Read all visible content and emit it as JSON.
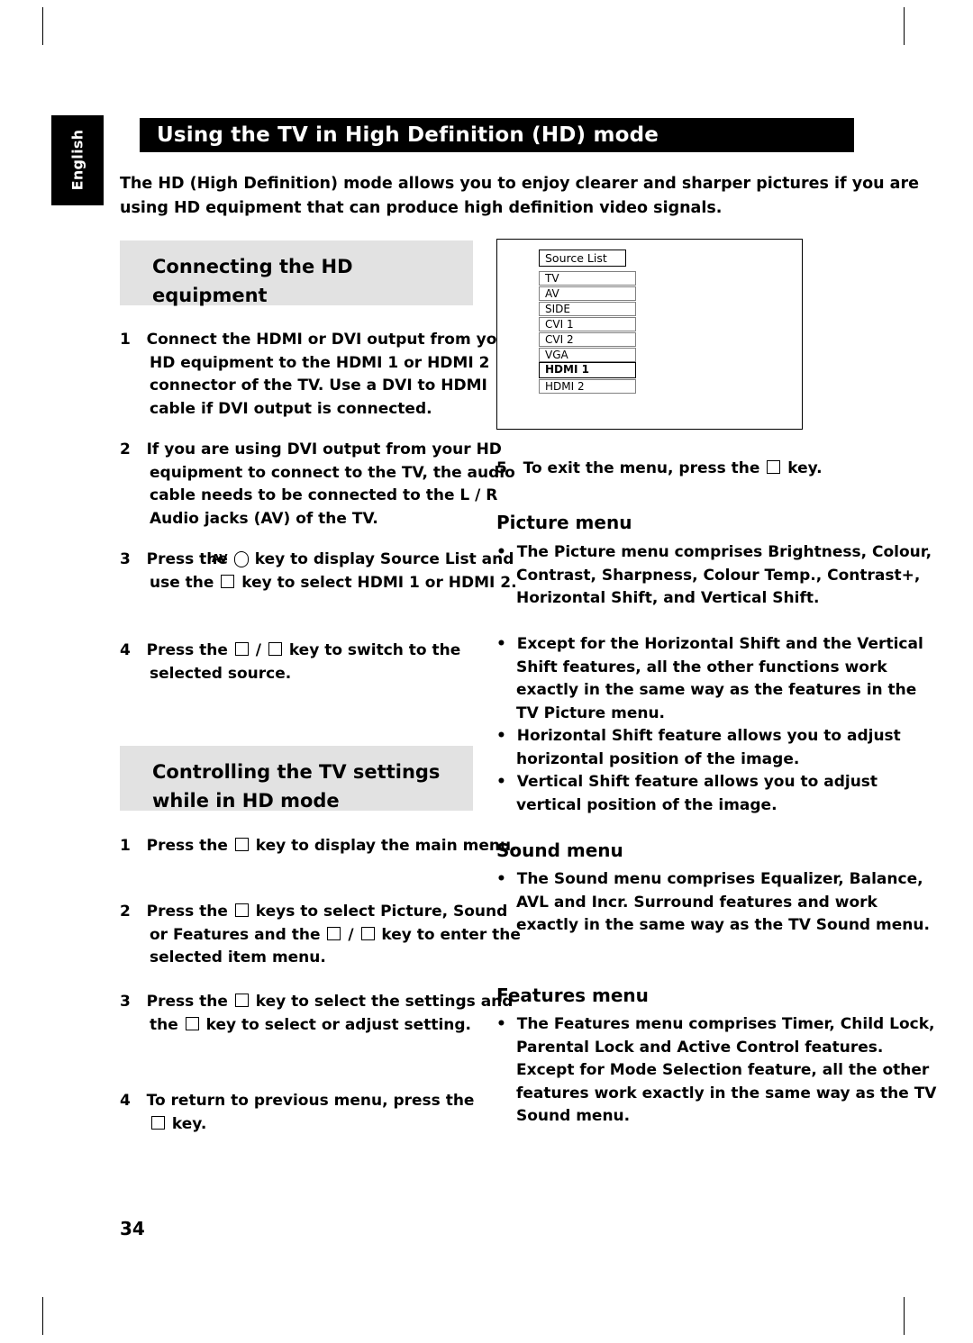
{
  "language_tab": "English",
  "title": "Using the TV in High Definition (HD) mode",
  "intro": "The HD (High Definition) mode allows you to enjoy clearer and sharper pictures if you are using HD equipment that can produce high definition video signals.",
  "headings": {
    "connecting": "Connecting the HD equipment",
    "controlling": "Controlling the TV settings while in HD mode",
    "picture_menu": "Picture menu",
    "sound_menu": "Sound menu",
    "features_menu": "Features menu"
  },
  "connecting_steps": [
    {
      "num": "1",
      "text": "Connect the HDMI or DVI output from your HD equipment to the HDMI 1 or HDMI 2 connector of the TV. Use a DVI to HDMI cable if DVI output is connected."
    },
    {
      "num": "2",
      "text": "If you are using DVI output from your HD equipment to connect to the TV, the audio cable needs to be connected to the L / R Audio jacks (AV) of the TV."
    },
    {
      "num": "3",
      "part1": "Press the",
      "key1": "AV",
      "part2": "key to display Source List and use the",
      "key2": "▲▼",
      "part3": "key to select",
      "bold1": "HDMI 1",
      "part4": "or",
      "bold2": "HDMI 2",
      "part5": "."
    },
    {
      "num": "4",
      "part1": "Press the",
      "key1": "►",
      "sep": "/",
      "key2": "OK",
      "part2": "key to switch to the selected source."
    }
  ],
  "controlling_steps": [
    {
      "num": "1",
      "part1": "Press the",
      "key1": "MENU",
      "part2": "key to display the main menu."
    },
    {
      "num": "2",
      "part1": "Press the",
      "key1": "▲▼",
      "part2": "keys to select Picture, Sound or Features and the",
      "key2": "►",
      "sep": "/",
      "key3": "OK",
      "part3": "key to enter the selected item menu."
    },
    {
      "num": "3",
      "part1": "Press the",
      "key1": "▲▼",
      "part2": "key to select the settings and the",
      "key2": "◄►",
      "part3": "key to select or adjust setting."
    },
    {
      "num": "4",
      "part1": "To return to previous menu, press the",
      "key1": "MENU",
      "part2": "key."
    }
  ],
  "source_list": {
    "title": "Source List",
    "items": [
      "TV",
      "AV",
      "SIDE",
      "CVI 1",
      "CVI 2",
      "VGA",
      "HDMI 1",
      "HDMI 2"
    ],
    "selected": "HDMI 1"
  },
  "exit_note": {
    "num": "5",
    "part1": "To exit the menu, press the",
    "key1": "MENU",
    "part2": "key."
  },
  "picture_bullets": [
    {
      "segments": [
        {
          "t": "The Picture menu comprises ",
          "b": false
        },
        {
          "t": "Brightness, Colour, Contrast, Sharpness, Colour Temp., Contrast+, Horizontal Shift,",
          "b": true
        },
        {
          "t": " and ",
          "b": false
        },
        {
          "t": "Vertical Shift",
          "b": true
        },
        {
          "t": ".",
          "b": false
        }
      ]
    },
    {
      "segments": [
        {
          "t": "Except for the ",
          "b": false
        },
        {
          "t": "Horizontal Shift",
          "b": true
        },
        {
          "t": " and the ",
          "b": false
        },
        {
          "t": "Vertical Shift",
          "b": true
        },
        {
          "t": " features, all the other functions work exactly in the same way as the features in the ",
          "b": false
        },
        {
          "t": "TV Picture",
          "b": true
        },
        {
          "t": " menu.",
          "b": false
        }
      ]
    },
    {
      "segments": [
        {
          "t": "Horizontal Shift feature allows you to adjust horizontal position of the image.",
          "b": false
        }
      ]
    },
    {
      "segments": [
        {
          "t": "Vertical Shift feature allows you to adjust vertical position of the image.",
          "b": false
        }
      ]
    }
  ],
  "sound_bullets": [
    {
      "segments": [
        {
          "t": "The Sound menu comprises ",
          "b": false
        },
        {
          "t": "Equalizer, Balance, AVL",
          "b": true
        },
        {
          "t": " and ",
          "b": false
        },
        {
          "t": "Incr. Surround",
          "b": true
        },
        {
          "t": " features and work exactly in the same way as the ",
          "b": false
        },
        {
          "t": "TV Sound",
          "b": true
        },
        {
          "t": " menu.",
          "b": false
        }
      ]
    }
  ],
  "features_bullets": [
    {
      "segments": [
        {
          "t": "The Features menu comprises ",
          "b": false
        },
        {
          "t": "Timer, Child Lock, Parental Lock",
          "b": true
        },
        {
          "t": " and ",
          "b": false
        },
        {
          "t": "Active Control",
          "b": true
        },
        {
          "t": " features. Except for ",
          "b": false
        },
        {
          "t": "Mode Selection",
          "b": true
        },
        {
          "t": " feature, all the other features work exactly in the same way as the ",
          "b": false
        },
        {
          "t": "TV Sound",
          "b": true
        },
        {
          "t": " menu.",
          "b": false
        }
      ]
    }
  ],
  "page_number": "34"
}
